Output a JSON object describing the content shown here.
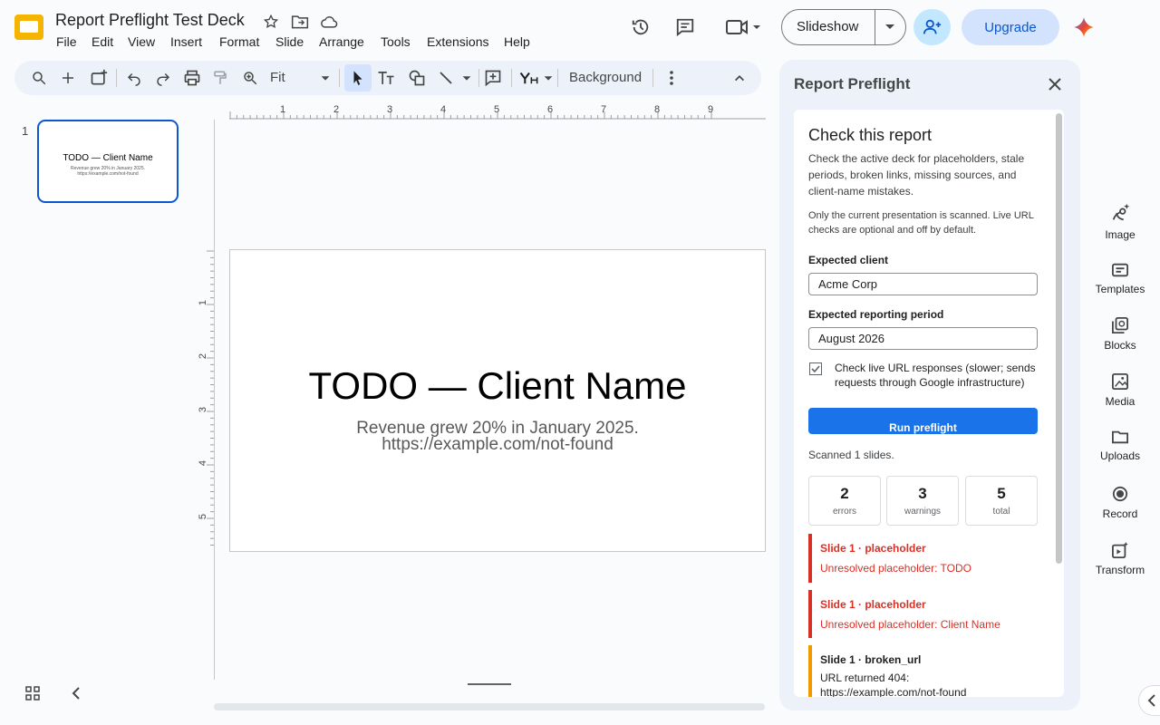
{
  "title": "Report Preflight Test Deck",
  "menu": [
    "File",
    "Edit",
    "View",
    "Insert",
    "Format",
    "Slide",
    "Arrange",
    "Tools",
    "Extensions",
    "Help"
  ],
  "header": {
    "slideshow": "Slideshow",
    "upgrade": "Upgrade"
  },
  "toolbar": {
    "zoom": "Fit",
    "background": "Background"
  },
  "ruler": {
    "h": [
      "1",
      "2",
      "3",
      "4",
      "5",
      "6",
      "7",
      "8",
      "9"
    ],
    "v": [
      "1",
      "2",
      "3",
      "4",
      "5"
    ]
  },
  "slide": {
    "number": "1",
    "title": "TODO — Client Name",
    "body1": "Revenue grew 20% in January 2025.",
    "body2": "https://example.com/not-found"
  },
  "panel": {
    "title": "Report Preflight",
    "heading": "Check this report",
    "desc": "Check the active deck for placeholders, stale periods, broken links, missing sources, and client-name mistakes.",
    "note": "Only the current presentation is scanned. Live URL checks are optional and off by default.",
    "client_label": "Expected client",
    "client_value": "Acme Corp",
    "period_label": "Expected reporting period",
    "period_value": "August 2026",
    "checkbox_label": "Check live URL responses (slower; sends requests through Google infrastructure)",
    "run": "Run preflight",
    "scanned": "Scanned 1 slides.",
    "stats": [
      {
        "n": "2",
        "l": "errors"
      },
      {
        "n": "3",
        "l": "warnings"
      },
      {
        "n": "5",
        "l": "total"
      }
    ],
    "issues": [
      {
        "h": "Slide 1 · placeholder",
        "d": "Unresolved placeholder: TODO",
        "level": "error"
      },
      {
        "h": "Slide 1 · placeholder",
        "d": "Unresolved placeholder: Client Name",
        "level": "error"
      },
      {
        "h": "Slide 1 · broken_url",
        "d": "URL returned 404: https://example.com/not-found",
        "level": "warning"
      }
    ]
  },
  "rail": [
    "Image",
    "Templates",
    "Blocks",
    "Media",
    "Uploads",
    "Record",
    "Transform"
  ],
  "colors": {
    "accent": "#0b57d0",
    "error": "#d93025",
    "warning": "#f29900",
    "panel_bg": "#edf2fa"
  }
}
